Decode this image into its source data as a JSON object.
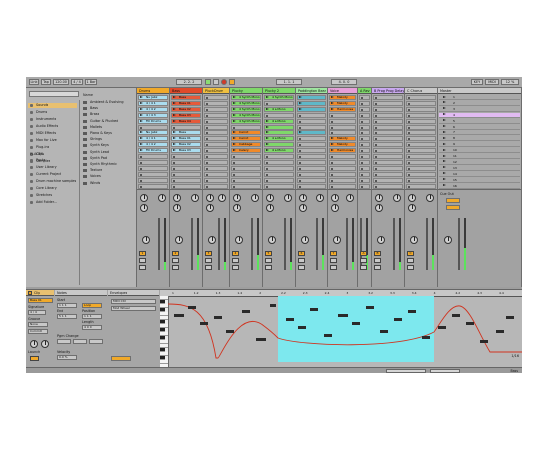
{
  "transport": {
    "link": "Link",
    "tap": "Tap",
    "tempo": "120.00",
    "sig": "4 / 4",
    "metro": "1 Bar",
    "pos": "2.   2.   2",
    "loop_start": "1.   1.   1",
    "loop_len": "4.   0.   0",
    "cpu": "12 %",
    "key_label": "KEY",
    "midi_label": "MIDI"
  },
  "browser": {
    "places_header": "PLACES",
    "categories": [
      {
        "label": "Sounds",
        "selected": true
      },
      {
        "label": "Drums",
        "selected": false
      },
      {
        "label": "Instruments",
        "selected": false
      },
      {
        "label": "Audio Effects",
        "selected": false
      },
      {
        "label": "MIDI Effects",
        "selected": false
      },
      {
        "label": "Max for Live",
        "selected": false
      },
      {
        "label": "Plug-ins",
        "selected": false
      },
      {
        "label": "Clips",
        "selected": false
      },
      {
        "label": "Samples",
        "selected": false
      }
    ],
    "places": [
      {
        "label": "Packs"
      },
      {
        "label": "User Library"
      },
      {
        "label": "Current Project"
      },
      {
        "label": "Drum machine samples"
      },
      {
        "label": "Core Library"
      },
      {
        "label": "Stretches"
      },
      {
        "label": "Add Folder..."
      }
    ],
    "name_header": "Name",
    "folders": [
      "Ambient & Evolving",
      "Bass",
      "Brass",
      "Guitar & Plucked",
      "Mallets",
      "Piano & Keys",
      "Strings",
      "Synth Keys",
      "Synth Lead",
      "Synth Pad",
      "Synth Rhythmic",
      "Texture",
      "Voices",
      "Winds"
    ]
  },
  "tracks": [
    {
      "name": "Drums",
      "color": "#f0a92a",
      "num": "1",
      "clips": [
        {
          "label": "Nu Jabz",
          "color": "#aadcee"
        },
        {
          "label": "4 / 4 1",
          "color": "#aadcee"
        },
        {
          "label": "4 / 4 2",
          "color": "#aadcee"
        },
        {
          "label": "4 / 4 3",
          "color": "#aadcee"
        },
        {
          "label": "Fill Drums",
          "color": "#aadcee"
        },
        {
          "label": "",
          "color": ""
        },
        {
          "label": "Nu Jabz",
          "color": "#aadcee"
        },
        {
          "label": "4 / 4 1",
          "color": "#aadcee"
        },
        {
          "label": "4 / 4 2",
          "color": "#aadcee"
        },
        {
          "label": "Fill Drums",
          "color": "#aadcee"
        }
      ]
    },
    {
      "name": "Bass",
      "color": "#e04a2a",
      "num": "2",
      "clips": [
        {
          "label": "Bass",
          "color": "#e55a3a"
        },
        {
          "label": "Bass 01",
          "color": "#e55a3a"
        },
        {
          "label": "Bass 02",
          "color": "#e55a3a"
        },
        {
          "label": "Bass 03",
          "color": "#e55a3a"
        },
        {
          "label": "Bass 04",
          "color": "#e55a3a"
        },
        {
          "label": "",
          "color": ""
        },
        {
          "label": "Bass",
          "color": "#aadcee"
        },
        {
          "label": "Bass 01",
          "color": "#aadcee"
        },
        {
          "label": "Bass 02",
          "color": "#aadcee"
        },
        {
          "label": "Bass 03",
          "color": "#aadcee"
        }
      ]
    },
    {
      "name": "PluckDrum",
      "color": "#f0c040",
      "num": "3",
      "clips": []
    },
    {
      "name": "Plucky",
      "color": "#7fd86a",
      "num": "4",
      "clips": [
        {
          "label": "4 Synth Mono",
          "color": "#7fd86a"
        },
        {
          "label": "4 Synth Mono",
          "color": "#7fd86a"
        },
        {
          "label": "4 Synth Mono",
          "color": "#7fd86a"
        },
        {
          "label": "4 Synth Mono",
          "color": "#7fd86a"
        },
        {
          "label": "4 Synth Mono",
          "color": "#7fd86a"
        },
        {
          "label": "",
          "color": ""
        },
        {
          "label": "Carrot",
          "color": "#f08a2a"
        },
        {
          "label": "Carrot",
          "color": "#f08a2a"
        },
        {
          "label": "Cabbage",
          "color": "#f08a2a"
        },
        {
          "label": "Celery",
          "color": "#f08a2a"
        }
      ]
    },
    {
      "name": "Plucky 2",
      "color": "#7fd86a",
      "num": "5",
      "clips": [
        {
          "label": "4 Synth Mono",
          "color": "#7fd86a"
        },
        {
          "label": "",
          "color": ""
        },
        {
          "label": "4 s.Mono",
          "color": "#7fd86a"
        },
        {
          "label": "",
          "color": ""
        },
        {
          "label": "4 s.Mono",
          "color": "#7fd86a"
        },
        {
          "label": "",
          "color": "#7fd86a"
        },
        {
          "label": "",
          "color": "#7fd86a"
        },
        {
          "label": "4 s.Mono",
          "color": "#7fd86a"
        },
        {
          "label": "",
          "color": "#7fd86a"
        },
        {
          "label": "4 s.Mono",
          "color": "#7fd86a"
        }
      ]
    },
    {
      "name": "Paddington Bear",
      "color": "#9fe6a0",
      "num": "6",
      "clips": [
        {
          "label": "",
          "color": "#5fb8c8"
        },
        {
          "label": "",
          "color": "#5fb8c8"
        },
        {
          "label": "",
          "color": "#5fb8c8"
        },
        {
          "label": "",
          "color": ""
        },
        {
          "label": "",
          "color": ""
        },
        {
          "label": "",
          "color": ""
        },
        {
          "label": "",
          "color": "#5fb8c8"
        },
        {
          "label": "",
          "color": ""
        },
        {
          "label": "",
          "color": ""
        },
        {
          "label": "",
          "color": ""
        }
      ]
    },
    {
      "name": "Voice",
      "color": "#e6a0d8",
      "num": "7",
      "clips": [
        {
          "label": "Melody",
          "color": "#f08a2a"
        },
        {
          "label": "Melody",
          "color": "#f08a2a"
        },
        {
          "label": "Harmonies",
          "color": "#f08a2a"
        },
        {
          "label": "",
          "color": ""
        },
        {
          "label": "",
          "color": ""
        },
        {
          "label": "",
          "color": ""
        },
        {
          "label": "",
          "color": ""
        },
        {
          "label": "Melody",
          "color": "#f08a2a"
        },
        {
          "label": "Melody",
          "color": "#f08a2a"
        },
        {
          "label": "Harmonies",
          "color": "#f08a2a"
        }
      ]
    },
    {
      "name": "A Rev",
      "color": "#7fd86a",
      "num": "A",
      "clips": []
    },
    {
      "name": "B Prog Prog Delay",
      "color": "#c9a8f0",
      "num": "B",
      "clips": []
    },
    {
      "name": "C Chorus",
      "color": "#c9c9c9",
      "num": "C",
      "clips": []
    }
  ],
  "master": {
    "name": "Master",
    "scenes": [
      "1",
      "2",
      "3",
      "4",
      "5",
      "6",
      "7",
      "8",
      "9",
      "10",
      "11",
      "12",
      "13",
      "14",
      "15",
      "16"
    ],
    "highlighted_scene": 3,
    "cue_label": "Cue Out",
    "master_label": "Master"
  },
  "clip_panel": {
    "title": "Clip",
    "clip_name": "Bass 01",
    "signature_label": "Signature",
    "sig_value": "4 / 4",
    "groove_label": "Groove",
    "groove_value": "None",
    "commit": "Commit",
    "launch": "Launch",
    "notes_title": "Notes",
    "start_label": "Start",
    "end_label": "End",
    "loop_label": "Loop",
    "position_label": "Position",
    "length_label": "Length",
    "pgm_label": "Pgm Change",
    "vel_label": "Velocity",
    "envelopes_title": "Envelopes",
    "env_device": "MIDI Ctrl",
    "env_control": "Mod Wheel",
    "start_value": "1  1  1",
    "end_value": "5  1  1",
    "position_value": "1  1  1",
    "length_value": "4  0  0",
    "vel_value": "0.0 %"
  },
  "pianoroll": {
    "ticks": [
      "1",
      "1.2",
      "1.3",
      "1.4",
      "2",
      "2.2",
      "2.3",
      "2.4",
      "3",
      "3.2",
      "3.3",
      "3.4",
      "4",
      "4.2",
      "4.3",
      "4.4"
    ],
    "fold_label": "Fold",
    "zoom_label": "1/16"
  },
  "status": {
    "label": "Bass"
  }
}
